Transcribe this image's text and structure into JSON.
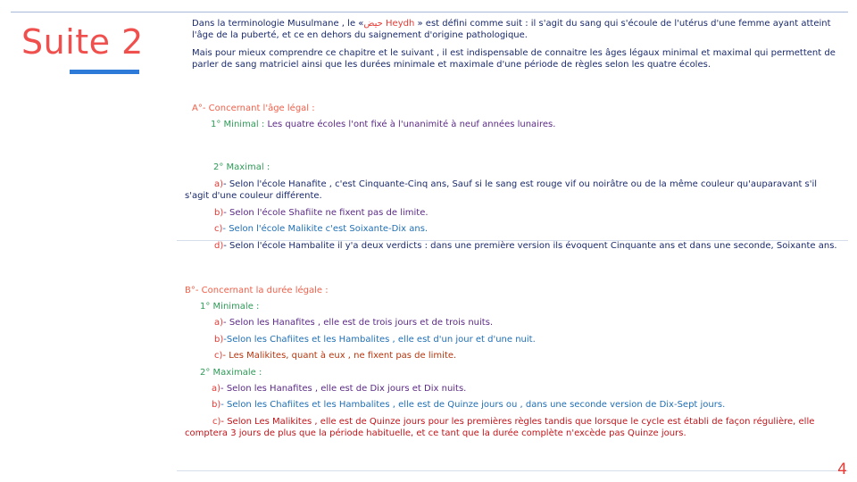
{
  "slide": {
    "title": "Suite 2",
    "page_number": "4"
  },
  "intro": {
    "p1_pre": "Dans la terminologie Musulmane , le «",
    "p1_arabic": "حيض",
    "p1_term": " Heydh",
    "p1_post": " » est défini comme suit : il s'agit du sang qui s'écoule de l'utérus d'une femme ayant atteint l'âge de la puberté, et ce en dehors du saignement d'origine pathologique.",
    "p2": "Mais pour mieux comprendre ce chapitre et le suivant , il est indispensable de connaitre les âges légaux minimal et maximal qui permettent de parler de sang matriciel ainsi que les durées minimale et maximale d'une période de règles selon les quatre écoles."
  },
  "section_a": {
    "heading": "A°- Concernant l'âge légal :",
    "minimal_label": "1° Minimal :",
    "minimal_text": " Les quatre écoles l'ont fixé à l'unanimité à neuf années lunaires.",
    "maximal_label": "2° Maximal :",
    "items": [
      {
        "letter": "a)",
        "text": "- Selon l'école Hanafite , c'est Cinquante-Cinq ans, Sauf si le sang est rouge vif ou noirâtre ou de la même couleur qu'auparavant s'il s'agit d'une couleur différente."
      },
      {
        "letter": "b)",
        "text": "- Selon l'école Shafiite ne fixent pas de limite."
      },
      {
        "letter": "c)",
        "text": "- Selon l'école Malikite c'est Soixante-Dix ans."
      },
      {
        "letter": "d)",
        "text": "- Selon l'école Hambalite il y'a deux verdicts : dans une première version ils évoquent Cinquante ans et dans une seconde, Soixante ans."
      }
    ]
  },
  "section_b": {
    "heading": "B°- Concernant la durée légale :",
    "minimal_label": "1° Minimale :",
    "minimal_items": [
      {
        "letter": "a)",
        "text": "- Selon les Hanafites , elle est de trois jours et de trois nuits."
      },
      {
        "letter": "b)",
        "text": "-Selon les Chafiites et les Hambalites , elle est d'un jour et d'une nuit."
      },
      {
        "letter": "c)",
        "text": "- Les Malikites, quant à eux , ne fixent pas de limite."
      }
    ],
    "maximal_label": "2° Maximale :",
    "maximal_items": [
      {
        "letter": "a)",
        "text": "- Selon les Hanafites , elle est de Dix jours et Dix nuits."
      },
      {
        "letter": "b)",
        "text": "- Selon les Chafiites et les Hambalites , elle est de Quinze jours ou , dans une seconde version de Dix-Sept jours."
      },
      {
        "letter": "c)",
        "text": "- Selon Les Malikites , elle est de Quinze jours pour les premières règles tandis que lorsque le cycle est établi de façon régulière, elle comptera 3 jours de plus que la période habituelle, et ce tant que la durée complète n'excède pas Quinze jours."
      }
    ]
  },
  "colors": {
    "title": "#f0504d",
    "underline": "#2e7ad8",
    "body_navy": "#1a2a6c",
    "heading_coral": "#f0604a",
    "label_green": "#2e9a57",
    "letter_red": "#e53a35"
  }
}
